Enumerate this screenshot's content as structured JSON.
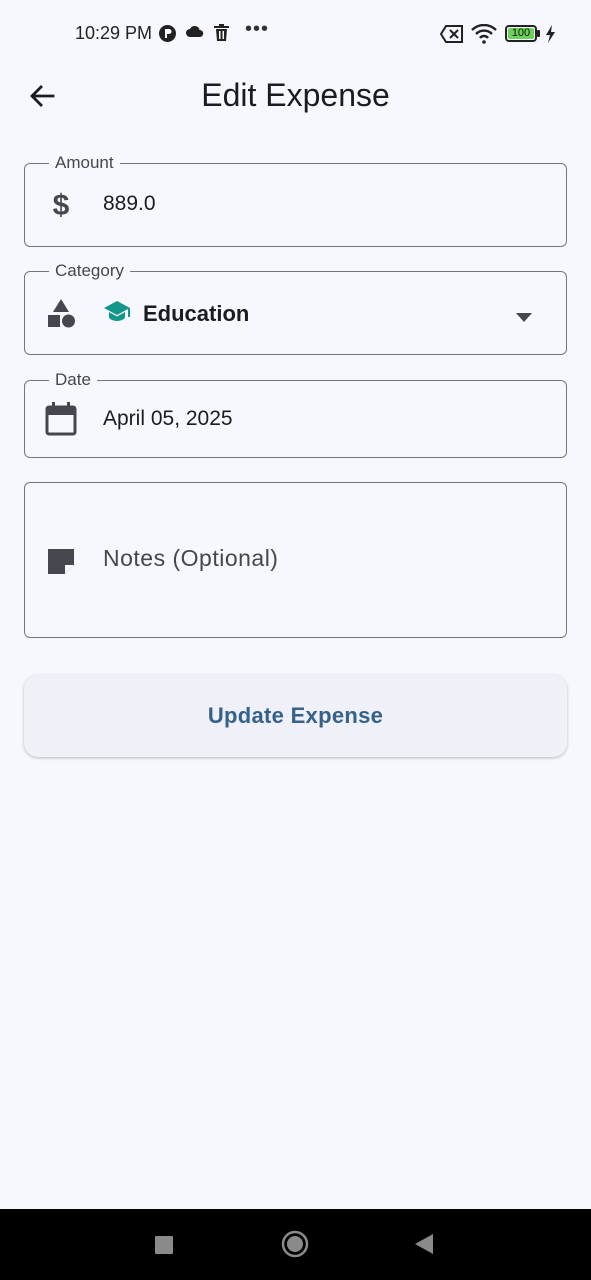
{
  "status_bar": {
    "time": "10:29 PM",
    "dots": "•••",
    "battery_level": "100",
    "icons": [
      "p-icon",
      "cloud-icon",
      "trash-icon",
      "sim-off-icon",
      "wifi-icon",
      "battery-icon",
      "charging-bolt-icon"
    ]
  },
  "app_bar": {
    "title": "Edit Expense",
    "back_icon": "arrow-back-icon"
  },
  "form": {
    "amount": {
      "label": "Amount",
      "value": "889.0",
      "icon": "dollar-icon"
    },
    "category": {
      "label": "Category",
      "value": "Education",
      "icon": "shapes-icon",
      "value_icon": "graduation-cap-icon",
      "accent": "#14968a"
    },
    "date": {
      "label": "Date",
      "value": "April 05, 2025",
      "icon": "calendar-icon"
    },
    "notes": {
      "placeholder": "Notes (Optional)",
      "icon": "note-icon"
    }
  },
  "actions": {
    "update_label": "Update Expense"
  },
  "nav_bar": {
    "items": [
      "recents-square-icon",
      "home-circle-icon",
      "back-triangle-icon"
    ]
  },
  "colors": {
    "background": "#f7f8fd",
    "primary_text": "#35618b",
    "outline": "#74777f"
  }
}
